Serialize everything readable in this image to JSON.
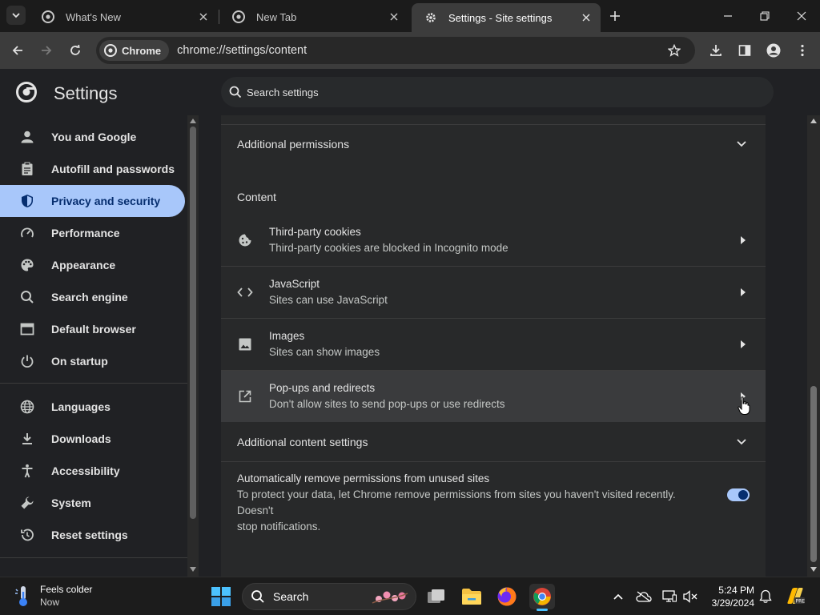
{
  "browser": {
    "tabs": [
      {
        "title": "What's New"
      },
      {
        "title": "New Tab"
      },
      {
        "title": "Settings - Site settings",
        "active": true
      }
    ],
    "chip_label": "Chrome",
    "url": "chrome://settings/content"
  },
  "settings": {
    "title": "Settings",
    "search_placeholder": "Search settings"
  },
  "sidebar": {
    "items": [
      {
        "label": "You and Google",
        "icon": "person-icon"
      },
      {
        "label": "Autofill and passwords",
        "icon": "clipboard-icon"
      },
      {
        "label": "Privacy and security",
        "icon": "shield-icon",
        "active": true
      },
      {
        "label": "Performance",
        "icon": "speedometer-icon"
      },
      {
        "label": "Appearance",
        "icon": "palette-icon"
      },
      {
        "label": "Search engine",
        "icon": "search-icon"
      },
      {
        "label": "Default browser",
        "icon": "browser-window-icon"
      },
      {
        "label": "On startup",
        "icon": "power-icon"
      },
      {
        "label": "Languages",
        "icon": "globe-icon"
      },
      {
        "label": "Downloads",
        "icon": "download-icon"
      },
      {
        "label": "Accessibility",
        "icon": "accessibility-icon"
      },
      {
        "label": "System",
        "icon": "wrench-icon"
      },
      {
        "label": "Reset settings",
        "icon": "history-icon"
      }
    ]
  },
  "main": {
    "additional_permissions": "Additional permissions",
    "content_heading": "Content",
    "items": [
      {
        "label": "Third-party cookies",
        "sub": "Third-party cookies are blocked in Incognito mode",
        "icon": "cookie-icon"
      },
      {
        "label": "JavaScript",
        "sub": "Sites can use JavaScript",
        "icon": "code-icon"
      },
      {
        "label": "Images",
        "sub": "Sites can show images",
        "icon": "image-icon"
      },
      {
        "label": "Pop-ups and redirects",
        "sub": "Don't allow sites to send pop-ups or use redirects",
        "icon": "open-in-new-icon"
      }
    ],
    "additional_content": "Additional content settings",
    "auto_remove": {
      "label": "Automatically remove permissions from unused sites",
      "desc_line1": "To protect your data, let Chrome remove permissions from sites you haven't visited recently. Doesn't",
      "desc_line2": "stop notifications.",
      "enabled": true
    }
  },
  "taskbar": {
    "weather_title": "Feels colder",
    "weather_sub": "Now",
    "search_label": "Search",
    "time": "5:24 PM",
    "date": "3/29/2024"
  },
  "colors": {
    "accent": "#a8c7fa",
    "accent_dark": "#062e6f",
    "background": "#202124",
    "card": "#28292a"
  }
}
